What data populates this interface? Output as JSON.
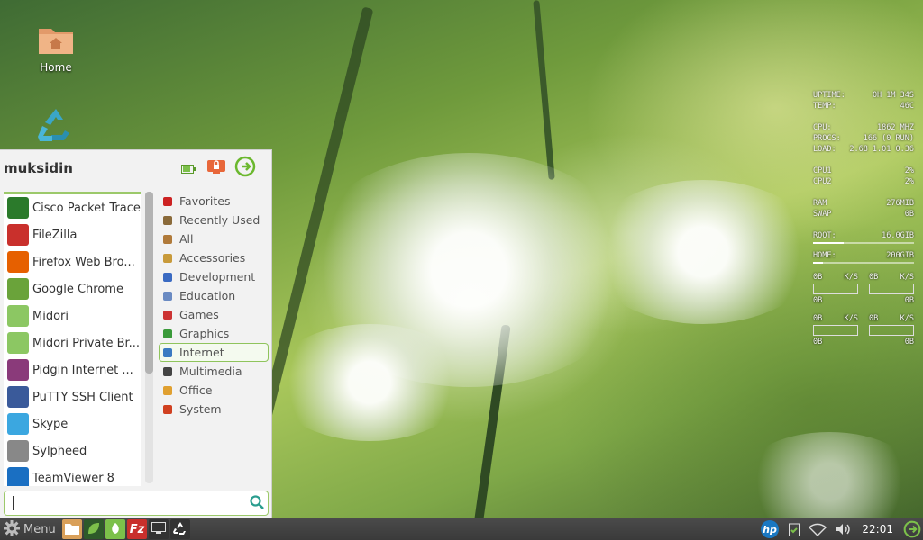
{
  "desktop": {
    "icons": [
      {
        "label": "Home"
      },
      {
        "label": ""
      }
    ]
  },
  "conky": {
    "uptime_label": "UPTIME:",
    "uptime": "0H 1M 34S",
    "temp_label": "TEMP:",
    "temp": "46C",
    "cpu_label": "CPU:",
    "cpu": "1862 MHZ",
    "procs_label": "PROCS:",
    "procs": "166 (0 RUN)",
    "load_label": "LOAD:",
    "load": "2.68 1.01 0.36",
    "cpu1_label": "CPU1",
    "cpu1": "2%",
    "cpu2_label": "CPU2",
    "cpu2": "2%",
    "ram_label": "RAM",
    "ram": "276MIB",
    "swap_label": "SWAP",
    "swap": "0B",
    "root_label": "ROOT:",
    "root": "16.0GIB",
    "root_fill": 0.3,
    "home_label": "HOME:",
    "home": "200GIB",
    "home_fill": 0.1,
    "net": [
      {
        "down": "0B",
        "rate": "K/S",
        "up": "0B",
        "up_rate": "K/S",
        "tot1": "0B",
        "tot2": "0B"
      },
      {
        "down": "0B",
        "rate": "K/S",
        "up": "0B",
        "up_rate": "K/S",
        "tot1": "0B",
        "tot2": "0B"
      }
    ]
  },
  "menu": {
    "user": "muksidin",
    "apps": [
      {
        "label": "Cisco Packet Tracer",
        "icon": "cisco-icon",
        "color": "#2b7a2b"
      },
      {
        "label": "FileZilla",
        "icon": "filezilla-icon",
        "color": "#c9302c"
      },
      {
        "label": "Firefox Web Bro...",
        "icon": "firefox-icon",
        "color": "#e66000"
      },
      {
        "label": "Google Chrome",
        "icon": "chrome-icon",
        "color": "#6aa33a"
      },
      {
        "label": "Midori",
        "icon": "midori-icon",
        "color": "#8cc763"
      },
      {
        "label": "Midori Private Br...",
        "icon": "midori-private-icon",
        "color": "#8cc763"
      },
      {
        "label": "Pidgin Internet ...",
        "icon": "pidgin-icon",
        "color": "#8a3a7a"
      },
      {
        "label": "PuTTY SSH Client",
        "icon": "putty-icon",
        "color": "#3a5a9a"
      },
      {
        "label": "Skype",
        "icon": "skype-icon",
        "color": "#3ba7e0"
      },
      {
        "label": "Sylpheed",
        "icon": "sylpheed-icon",
        "color": "#888888"
      },
      {
        "label": "TeamViewer 8",
        "icon": "teamviewer-icon",
        "color": "#1a6fc2"
      }
    ],
    "categories": [
      {
        "label": "Favorites",
        "icon": "bookmark-icon",
        "color": "#cc2222"
      },
      {
        "label": "Recently Used",
        "icon": "recent-icon",
        "color": "#8a6a3a"
      },
      {
        "label": "All",
        "icon": "all-icon",
        "color": "#b07a3a"
      },
      {
        "label": "Accessories",
        "icon": "accessories-icon",
        "color": "#c89a3a"
      },
      {
        "label": "Development",
        "icon": "wrench-icon",
        "color": "#3a6ac2"
      },
      {
        "label": "Education",
        "icon": "flask-icon",
        "color": "#6a8ac2"
      },
      {
        "label": "Games",
        "icon": "gamepad-icon",
        "color": "#cc3333"
      },
      {
        "label": "Graphics",
        "icon": "brush-icon",
        "color": "#3a9a3a"
      },
      {
        "label": "Internet",
        "icon": "globe-icon",
        "color": "#3a7ac2"
      },
      {
        "label": "Multimedia",
        "icon": "music-icon",
        "color": "#444444"
      },
      {
        "label": "Office",
        "icon": "document-icon",
        "color": "#e0a030"
      },
      {
        "label": "System",
        "icon": "info-icon",
        "color": "#d04020"
      }
    ],
    "selected_category": "Internet",
    "search_value": ""
  },
  "taskbar": {
    "menu_label": "Menu",
    "clock": "22:01"
  }
}
